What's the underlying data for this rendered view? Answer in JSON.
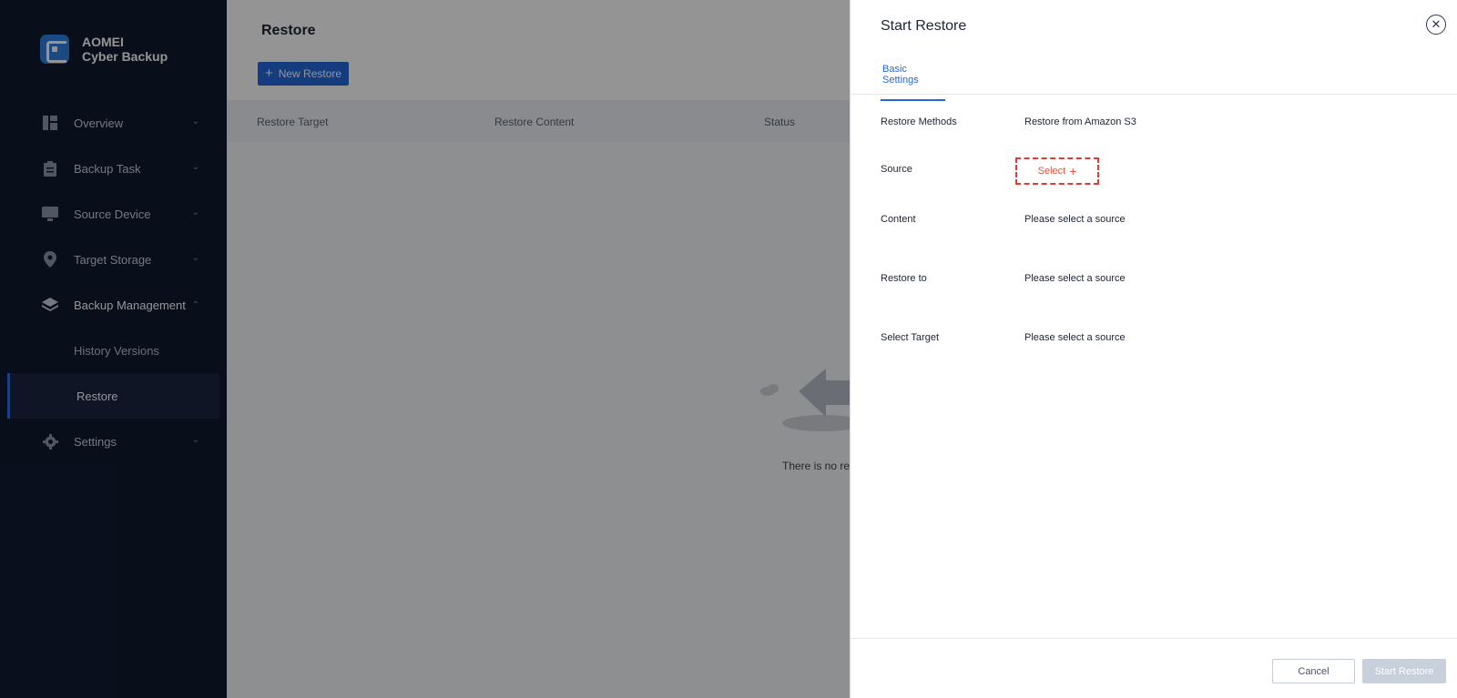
{
  "app": {
    "brand_line1": "AOMEI",
    "brand_line2": "Cyber Backup"
  },
  "sidebar": {
    "items": [
      {
        "label": "Overview",
        "icon": "dashboard-icon"
      },
      {
        "label": "Backup Task",
        "icon": "clipboard-icon"
      },
      {
        "label": "Source Device",
        "icon": "monitor-icon"
      },
      {
        "label": "Target Storage",
        "icon": "location-pin-icon"
      },
      {
        "label": "Backup Management",
        "icon": "layers-icon",
        "open": true
      },
      {
        "label": "Settings",
        "icon": "gear-icon"
      }
    ],
    "sub_items": [
      {
        "label": "History Versions"
      },
      {
        "label": "Restore",
        "active": true
      }
    ]
  },
  "main": {
    "title": "Restore",
    "new_button": "New Restore",
    "columns": [
      "Restore Target",
      "Restore Content",
      "Status"
    ],
    "empty_text": "There is no res"
  },
  "drawer": {
    "title": "Start Restore",
    "tab": "Basic Settings",
    "rows": [
      {
        "label": "Restore Methods",
        "value": "Restore from Amazon S3"
      },
      {
        "label": "Source",
        "value": "Select"
      },
      {
        "label": "Content",
        "value": "Please select a source"
      },
      {
        "label": "Restore to",
        "value": "Please select a source"
      },
      {
        "label": "Select Target",
        "value": "Please select a source"
      }
    ],
    "cancel": "Cancel",
    "start": "Start Restore"
  },
  "colors": {
    "accent": "#2468d9",
    "sidebar_bg": "#0f1a30",
    "highlight": "#e53935"
  }
}
